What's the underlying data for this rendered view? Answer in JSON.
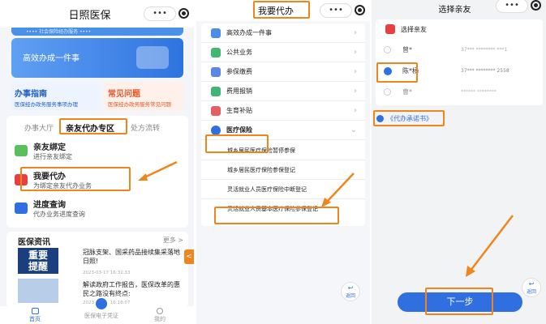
{
  "p1": {
    "title": "日照医保",
    "capsule": "•••",
    "banner_small": "•••• 社会保险经办服务 ••••",
    "banner_title": "高效办成一件事",
    "guide": {
      "title": "办事指南",
      "sub": "医保经办政务服务事项办理"
    },
    "faq": {
      "title": "常见问题",
      "sub": "医保经办政务服务常见问题"
    },
    "tabs": [
      "办事大厅",
      "亲友代办专区",
      "处方流转"
    ],
    "items": [
      {
        "title": "亲友绑定",
        "sub": "进行亲友绑定"
      },
      {
        "title": "我要代办",
        "sub": "为绑定亲友代办业务"
      },
      {
        "title": "进度查询",
        "sub": "代办业务进度查询"
      }
    ],
    "news": {
      "title": "医保资讯",
      "more": "更多 >",
      "thumb": "重要\n提醒",
      "a1": {
        "title": "冠脉支架、国采药品接续集采落地日照!",
        "time": "2023-03-17 16:32:33"
      },
      "a2": {
        "title": "解读政府工作报告，医保改革的惠民之路没有终点:",
        "time": "2023-03-17 16:18:07"
      }
    },
    "nav": [
      "首页",
      "医保电子凭证",
      "我的"
    ],
    "side_arrow": "<"
  },
  "p2": {
    "title": "我要代办",
    "capsule": "•••",
    "items": [
      "高效办成一件事",
      "公共业务",
      "参保缴费",
      "费用报销",
      "生育补贴",
      "医疗保险"
    ],
    "subitems": [
      "城乡居民医疗保险暂停参保",
      "城乡居民医疗保险参保登记",
      "灵活就业人员医疗保险中断登记",
      "灵活就业人员基本医疗保险参保登记"
    ],
    "back": "返回"
  },
  "p3": {
    "title": "选择亲友",
    "capsule": "•••",
    "header": "选择亲友",
    "people": [
      {
        "name": "曾*",
        "id": "37*** ******** ***1"
      },
      {
        "name": "陈*杨",
        "id": "37*** ******** 2558"
      },
      {
        "name": "曹*",
        "id": "****** ********"
      }
    ],
    "agreement": "《代办承诺书》",
    "next": "下一步",
    "back": "返回"
  },
  "colors": {
    "accent": "#2f6fe0",
    "highlight": "#f0851d",
    "red": "#e84040"
  }
}
